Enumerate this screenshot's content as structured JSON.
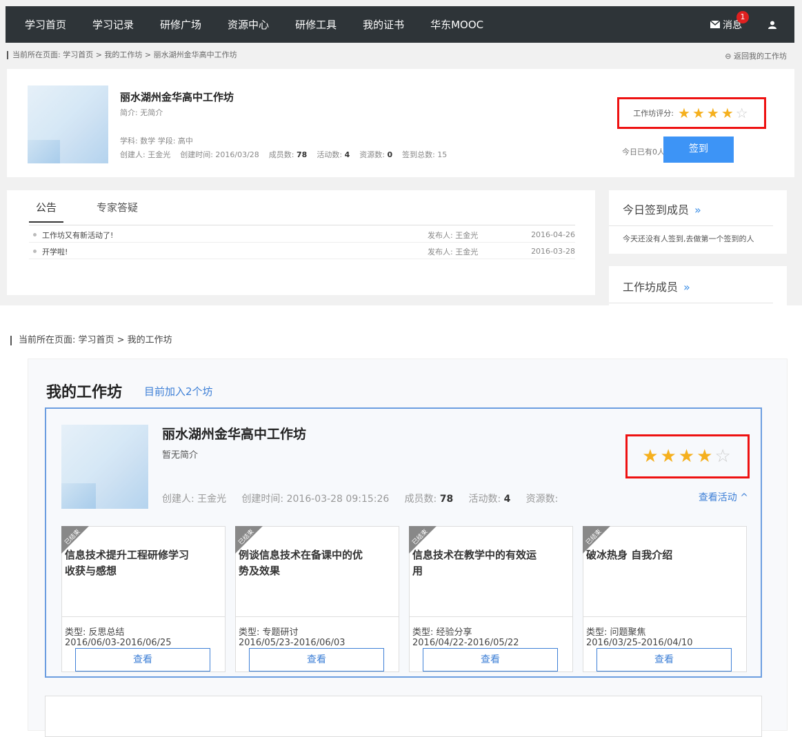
{
  "nav": {
    "items": [
      "学习首页",
      "学习记录",
      "研修广场",
      "资源中心",
      "研修工具",
      "我的证书",
      "华东MOOC"
    ],
    "messages_label": "消息",
    "messages_badge": "1"
  },
  "top": {
    "breadcrumb": "当前所在页面: 学习首页 > 我的工作坊 > 丽水湖州金华高中工作坊",
    "back_label": "返回我的工作坊",
    "workshop": {
      "title": "丽水湖州金华高中工作坊",
      "intro": "简介: 无简介",
      "subject_line": "学科: 数学   学段: 高中",
      "creator": "创建人: 王金光",
      "created": "创建时间: 2016/03/28",
      "members_label": "成员数:",
      "members": "78",
      "activities_label": "活动数:",
      "activities": "4",
      "resources_label": "资源数:",
      "resources": "0",
      "signin_total": "签到总数: 15"
    },
    "rating_label": "工作坊评分:",
    "rating_stars": 4,
    "rating_max": 5,
    "today_signed": "今日已有0人签到",
    "sign_button": "签到",
    "tabs": [
      "公告",
      "专家答疑"
    ],
    "announcements": [
      {
        "title": "工作坊又有新活动了!",
        "publisher": "发布人: 王金光",
        "date": "2016-04-26"
      },
      {
        "title": "开学啦!",
        "publisher": "发布人: 王金光",
        "date": "2016-03-28"
      }
    ],
    "side": {
      "today_members": "今日签到成员",
      "arrow": "»",
      "no_signin": "今天还没有人签到,去做第一个签到的人",
      "members": "工作坊成员"
    }
  },
  "bottom": {
    "breadcrumb": "当前所在页面: 学习首页 > 我的工作坊",
    "heading": "我的工作坊",
    "joined": "目前加入2个坊",
    "workshop": {
      "title": "丽水湖州金华高中工作坊",
      "intro": "暂无简介",
      "creator": "创建人: 王金光",
      "created": "创建时间: 2016-03-28 09:15:26",
      "members_label": "成员数:",
      "members": "78",
      "activities_label": "活动数:",
      "activities": "4",
      "resources_label": "资源数:"
    },
    "view_activities": "查看活动 ^",
    "rating_stars": 4,
    "activities": [
      {
        "tag": "已结束",
        "title": "信息技术提升工程研修学习收获与感想",
        "type": "类型: 反思总结",
        "dates": "2016/06/03-2016/06/25",
        "button": "查看"
      },
      {
        "tag": "已结束",
        "title": "例谈信息技术在备课中的优势及效果",
        "type": "类型: 专题研讨",
        "dates": "2016/05/23-2016/06/03",
        "button": "查看"
      },
      {
        "tag": "已结束",
        "title": "信息技术在教学中的有效运用",
        "type": "类型: 经验分享",
        "dates": "2016/04/22-2016/05/22",
        "button": "查看"
      },
      {
        "tag": "已结束",
        "title": "破冰热身 自我介绍",
        "type": "类型: 问题聚焦",
        "dates": "2016/03/25-2016/04/10",
        "button": "查看"
      }
    ]
  },
  "colors": {
    "nav_bg": "#2e3438",
    "accent": "#3d94f6",
    "highlight_box": "#e11111",
    "star": "#f5b01e"
  }
}
